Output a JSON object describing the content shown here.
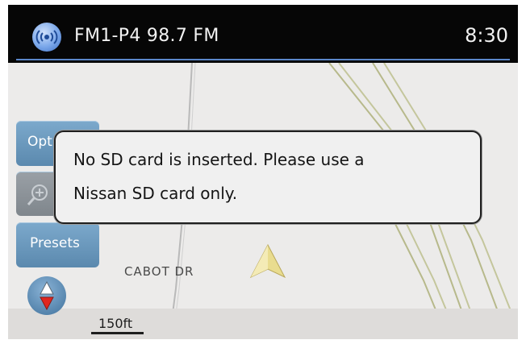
{
  "header": {
    "station": "FM1-P4 98.7 FM",
    "time": "8:30",
    "icon": "radio-icon",
    "accent_color": "#5a86c9"
  },
  "side_buttons": {
    "options_label": "Opt",
    "zoom_icon": "zoom-in-icon",
    "presets_label": "Presets",
    "compass_icon": "compass-icon"
  },
  "map": {
    "street_name": "CABOT DR",
    "scale": "150ft"
  },
  "dialog": {
    "line1": "No SD card is inserted. Please use a",
    "line2": "Nissan SD card only."
  }
}
